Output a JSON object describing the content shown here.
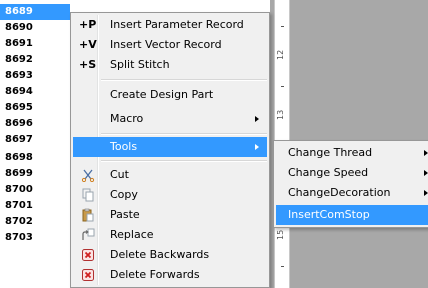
{
  "rows": [
    "8689",
    "8690",
    "8691",
    "8692",
    "8693",
    "8694",
    "8695",
    "8696",
    "8697",
    "8698",
    "8699",
    "8700",
    "8701",
    "8702",
    "8703"
  ],
  "selected_row": "8689",
  "ruler": {
    "labels": [
      "12",
      "13",
      "15"
    ]
  },
  "menu": {
    "items": [
      {
        "key": "+P",
        "label": "Insert Parameter Record"
      },
      {
        "key": "+V",
        "label": "Insert Vector Record"
      },
      {
        "key": "+S",
        "label": "Split Stitch"
      },
      {
        "key": "",
        "label": "Create Design Part"
      },
      {
        "key": "",
        "label": "Macro"
      },
      {
        "key": "",
        "label": "Tools"
      },
      {
        "key": "",
        "label": "Cut",
        "icon": "scissors-icon"
      },
      {
        "key": "",
        "label": "Copy",
        "icon": "copy-icon"
      },
      {
        "key": "",
        "label": "Paste",
        "icon": "paste-icon"
      },
      {
        "key": "",
        "label": "Replace",
        "icon": "replace-icon"
      },
      {
        "key": "",
        "label": "Delete Backwards",
        "icon": "delete-icon"
      },
      {
        "key": "",
        "label": "Delete Forwards",
        "icon": "delete-icon"
      }
    ]
  },
  "submenu": {
    "items": [
      {
        "label": "Change Thread"
      },
      {
        "label": "Change Speed"
      },
      {
        "label": "ChangeDecoration"
      },
      {
        "label": "InsertComStop"
      }
    ]
  },
  "colors": {
    "highlight": "#3399ff",
    "menu_bg": "#f0f0f0",
    "workspace_bg": "#a8a8a8"
  }
}
